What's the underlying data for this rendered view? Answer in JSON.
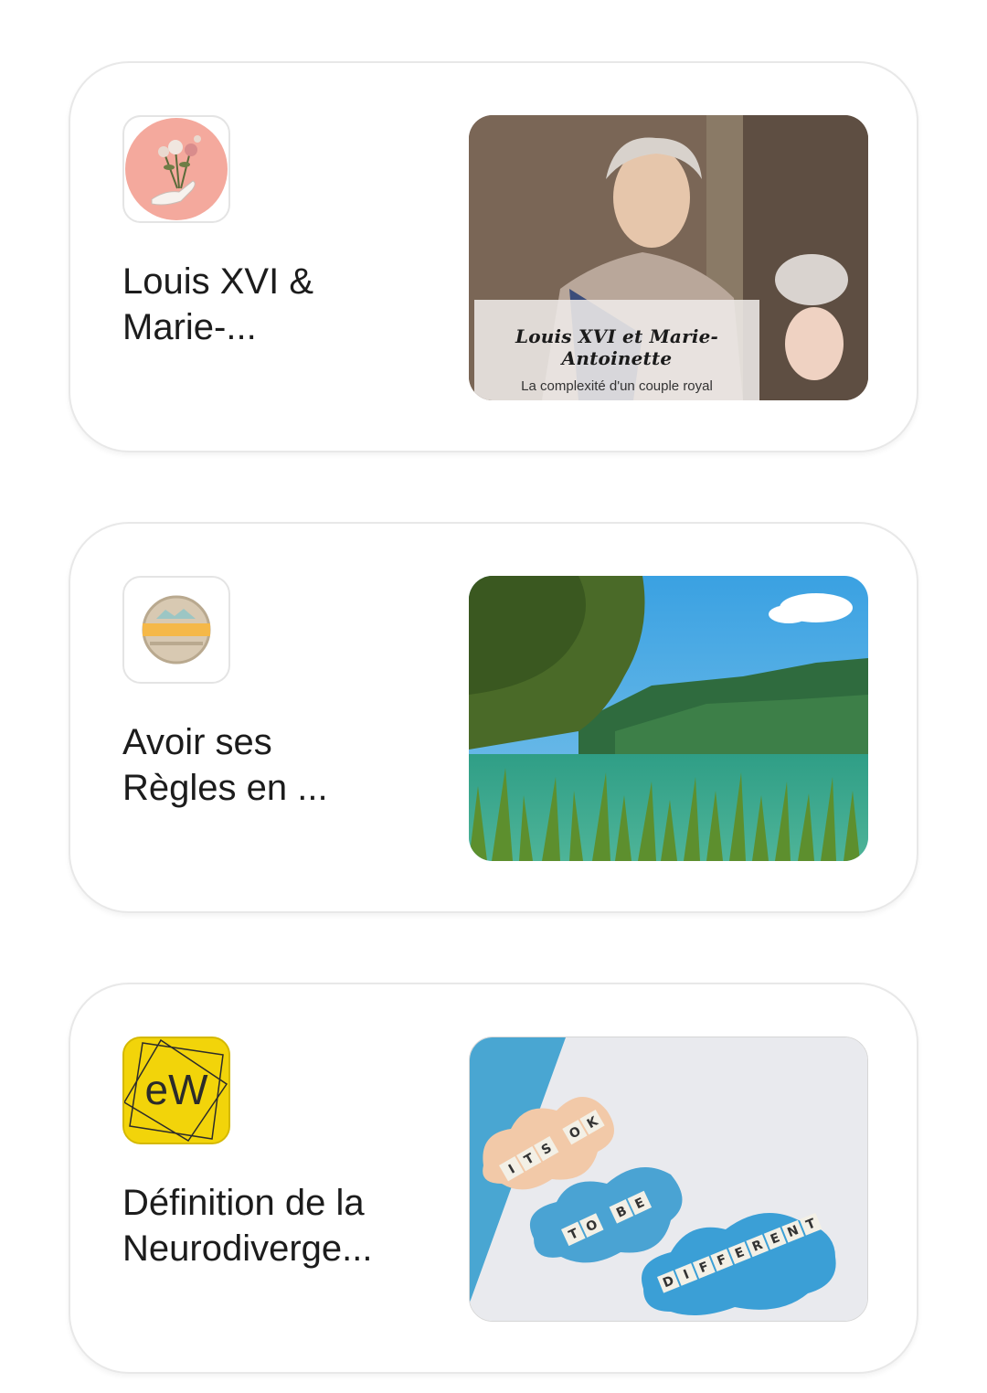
{
  "cards": [
    {
      "title": "Louis XVI &\nMarie-...",
      "logo_icon": "rose-hand-icon",
      "thumbnail": {
        "heading": "Louis XVI et Marie-Antoinette",
        "subheading": "La complexité d'un couple royal"
      }
    },
    {
      "title": "Avoir ses\nRègles en ...",
      "logo_icon": "badge-logo-icon",
      "thumbnail": {}
    },
    {
      "title": "Définition de la\nNeurodiverge...",
      "logo_icon": "ew-logo-icon",
      "logo_text": "eW",
      "thumbnail": {
        "tiles_line1": "IT'S OK",
        "tiles_line2": "TO BE",
        "tiles_line3": "DIFFERENT"
      }
    }
  ],
  "colors": {
    "card_border": "#e8e8e8",
    "text": "#1c1c1c",
    "ew_yellow": "#f2d40a",
    "rose_logo_bg": "#f4a99d"
  }
}
